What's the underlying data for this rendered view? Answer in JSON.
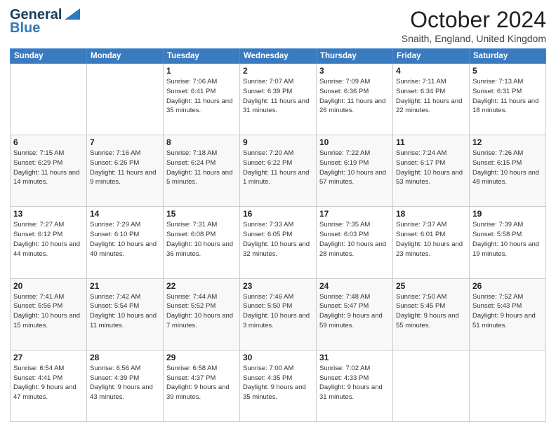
{
  "logo": {
    "line1": "General",
    "line2": "Blue"
  },
  "title": "October 2024",
  "location": "Snaith, England, United Kingdom",
  "days_header": [
    "Sunday",
    "Monday",
    "Tuesday",
    "Wednesday",
    "Thursday",
    "Friday",
    "Saturday"
  ],
  "weeks": [
    [
      {
        "num": "",
        "info": ""
      },
      {
        "num": "",
        "info": ""
      },
      {
        "num": "1",
        "info": "Sunrise: 7:06 AM\nSunset: 6:41 PM\nDaylight: 11 hours and 35 minutes."
      },
      {
        "num": "2",
        "info": "Sunrise: 7:07 AM\nSunset: 6:39 PM\nDaylight: 11 hours and 31 minutes."
      },
      {
        "num": "3",
        "info": "Sunrise: 7:09 AM\nSunset: 6:36 PM\nDaylight: 11 hours and 26 minutes."
      },
      {
        "num": "4",
        "info": "Sunrise: 7:11 AM\nSunset: 6:34 PM\nDaylight: 11 hours and 22 minutes."
      },
      {
        "num": "5",
        "info": "Sunrise: 7:13 AM\nSunset: 6:31 PM\nDaylight: 11 hours and 18 minutes."
      }
    ],
    [
      {
        "num": "6",
        "info": "Sunrise: 7:15 AM\nSunset: 6:29 PM\nDaylight: 11 hours and 14 minutes."
      },
      {
        "num": "7",
        "info": "Sunrise: 7:16 AM\nSunset: 6:26 PM\nDaylight: 11 hours and 9 minutes."
      },
      {
        "num": "8",
        "info": "Sunrise: 7:18 AM\nSunset: 6:24 PM\nDaylight: 11 hours and 5 minutes."
      },
      {
        "num": "9",
        "info": "Sunrise: 7:20 AM\nSunset: 6:22 PM\nDaylight: 11 hours and 1 minute."
      },
      {
        "num": "10",
        "info": "Sunrise: 7:22 AM\nSunset: 6:19 PM\nDaylight: 10 hours and 57 minutes."
      },
      {
        "num": "11",
        "info": "Sunrise: 7:24 AM\nSunset: 6:17 PM\nDaylight: 10 hours and 53 minutes."
      },
      {
        "num": "12",
        "info": "Sunrise: 7:26 AM\nSunset: 6:15 PM\nDaylight: 10 hours and 48 minutes."
      }
    ],
    [
      {
        "num": "13",
        "info": "Sunrise: 7:27 AM\nSunset: 6:12 PM\nDaylight: 10 hours and 44 minutes."
      },
      {
        "num": "14",
        "info": "Sunrise: 7:29 AM\nSunset: 6:10 PM\nDaylight: 10 hours and 40 minutes."
      },
      {
        "num": "15",
        "info": "Sunrise: 7:31 AM\nSunset: 6:08 PM\nDaylight: 10 hours and 36 minutes."
      },
      {
        "num": "16",
        "info": "Sunrise: 7:33 AM\nSunset: 6:05 PM\nDaylight: 10 hours and 32 minutes."
      },
      {
        "num": "17",
        "info": "Sunrise: 7:35 AM\nSunset: 6:03 PM\nDaylight: 10 hours and 28 minutes."
      },
      {
        "num": "18",
        "info": "Sunrise: 7:37 AM\nSunset: 6:01 PM\nDaylight: 10 hours and 23 minutes."
      },
      {
        "num": "19",
        "info": "Sunrise: 7:39 AM\nSunset: 5:58 PM\nDaylight: 10 hours and 19 minutes."
      }
    ],
    [
      {
        "num": "20",
        "info": "Sunrise: 7:41 AM\nSunset: 5:56 PM\nDaylight: 10 hours and 15 minutes."
      },
      {
        "num": "21",
        "info": "Sunrise: 7:42 AM\nSunset: 5:54 PM\nDaylight: 10 hours and 11 minutes."
      },
      {
        "num": "22",
        "info": "Sunrise: 7:44 AM\nSunset: 5:52 PM\nDaylight: 10 hours and 7 minutes."
      },
      {
        "num": "23",
        "info": "Sunrise: 7:46 AM\nSunset: 5:50 PM\nDaylight: 10 hours and 3 minutes."
      },
      {
        "num": "24",
        "info": "Sunrise: 7:48 AM\nSunset: 5:47 PM\nDaylight: 9 hours and 59 minutes."
      },
      {
        "num": "25",
        "info": "Sunrise: 7:50 AM\nSunset: 5:45 PM\nDaylight: 9 hours and 55 minutes."
      },
      {
        "num": "26",
        "info": "Sunrise: 7:52 AM\nSunset: 5:43 PM\nDaylight: 9 hours and 51 minutes."
      }
    ],
    [
      {
        "num": "27",
        "info": "Sunrise: 6:54 AM\nSunset: 4:41 PM\nDaylight: 9 hours and 47 minutes."
      },
      {
        "num": "28",
        "info": "Sunrise: 6:56 AM\nSunset: 4:39 PM\nDaylight: 9 hours and 43 minutes."
      },
      {
        "num": "29",
        "info": "Sunrise: 6:58 AM\nSunset: 4:37 PM\nDaylight: 9 hours and 39 minutes."
      },
      {
        "num": "30",
        "info": "Sunrise: 7:00 AM\nSunset: 4:35 PM\nDaylight: 9 hours and 35 minutes."
      },
      {
        "num": "31",
        "info": "Sunrise: 7:02 AM\nSunset: 4:33 PM\nDaylight: 9 hours and 31 minutes."
      },
      {
        "num": "",
        "info": ""
      },
      {
        "num": "",
        "info": ""
      }
    ]
  ]
}
